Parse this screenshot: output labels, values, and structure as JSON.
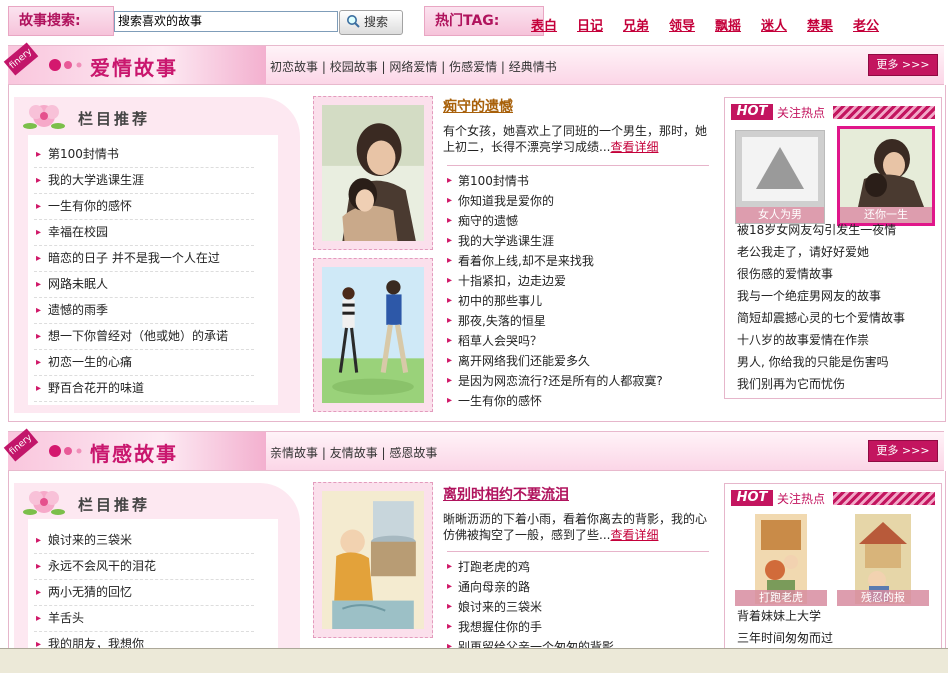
{
  "search": {
    "label": "故事搜索:",
    "value": "搜索喜欢的故事",
    "button": "搜索"
  },
  "hot_tags": {
    "label": "热门TAG:",
    "items": [
      "表白",
      "日记",
      "兄弟",
      "领导",
      "飘摇",
      "迷人",
      "禁果",
      "老公"
    ]
  },
  "love": {
    "badge": "finery",
    "title": "爱情故事",
    "links": [
      "初恋故事",
      "校园故事",
      "网络爱情",
      "伤感爱情",
      "经典情书"
    ],
    "more": "更多 >>>",
    "column": {
      "title": "栏目推荐",
      "items": [
        "第100封情书",
        "我的大学逃课生涯",
        "一生有你的感怀",
        "幸福在校园",
        "暗恋的日子 并不是我一个人在过",
        "网路未眠人",
        "遗憾的雨季",
        "想一下你曾经对（他或她）的承诺",
        "初恋一生的心痛",
        "野百合花开的味道"
      ]
    },
    "story": {
      "title": "痴守的遗憾",
      "text": "有个女孩，她喜欢上了同班的一个男生，那时，她上初二，长得不漂亮学习成绩...",
      "detail": "查看详细"
    },
    "list": [
      "第100封情书",
      "你知道我是爱你的",
      "痴守的遗憾",
      "我的大学逃课生涯",
      "看着你上线,却不是来找我",
      "十指紧扣，边走边爱",
      "初中的那些事儿",
      "那夜,失落的恒星",
      "稻草人会哭吗？",
      "离开网络我们还能爱多久",
      "是因为网恋流行?还是所有的人都寂寞?",
      "一生有你的感怀"
    ],
    "hot": {
      "tag": "HOT",
      "sub": "关注热点",
      "thumbs": [
        "女人为男",
        "还你一生"
      ],
      "items": [
        "被18岁女网友勾引发生一夜情",
        "老公我走了，请好好爱她",
        "很伤感的爱情故事",
        "我与一个绝症男网友的故事",
        "简短却震撼心灵的七个爱情故事",
        "十八岁的故事爱情在作祟",
        "男人, 你给我的只能是伤害吗",
        "我们别再为它而忧伤"
      ]
    }
  },
  "emotion": {
    "badge": "finery",
    "title": "情感故事",
    "links": [
      "亲情故事",
      "友情故事",
      "感恩故事"
    ],
    "more": "更多 >>>",
    "column": {
      "title": "栏目推荐",
      "items": [
        "娘讨来的三袋米",
        "永远不会风干的泪花",
        "两小无猜的回忆",
        "羊舌头",
        "我的朋友，我想你"
      ]
    },
    "story": {
      "title": "离别时相约不要流泪",
      "text": "晰晰沥沥的下着小雨，看着你离去的背影，我的心仿佛被掏空了一般，感到了些...",
      "detail": "查看详细"
    },
    "list": [
      "打跑老虎的鸡",
      "通向母亲的路",
      "娘讨来的三袋米",
      "我想握住你的手",
      "别再留给父亲一个匆匆的背影"
    ],
    "hot": {
      "tag": "HOT",
      "sub": "关注热点",
      "thumbs": [
        "打跑老虎",
        "残忍的报"
      ],
      "items": [
        "背着妹妹上大学",
        "三年时间匆匆而过"
      ]
    }
  },
  "colors": {
    "accent": "#c3155f",
    "link_red": "#c4003a",
    "title_brown": "#a8600a",
    "title_pink": "#b0135d",
    "panel_pink": "#fde8f1"
  }
}
